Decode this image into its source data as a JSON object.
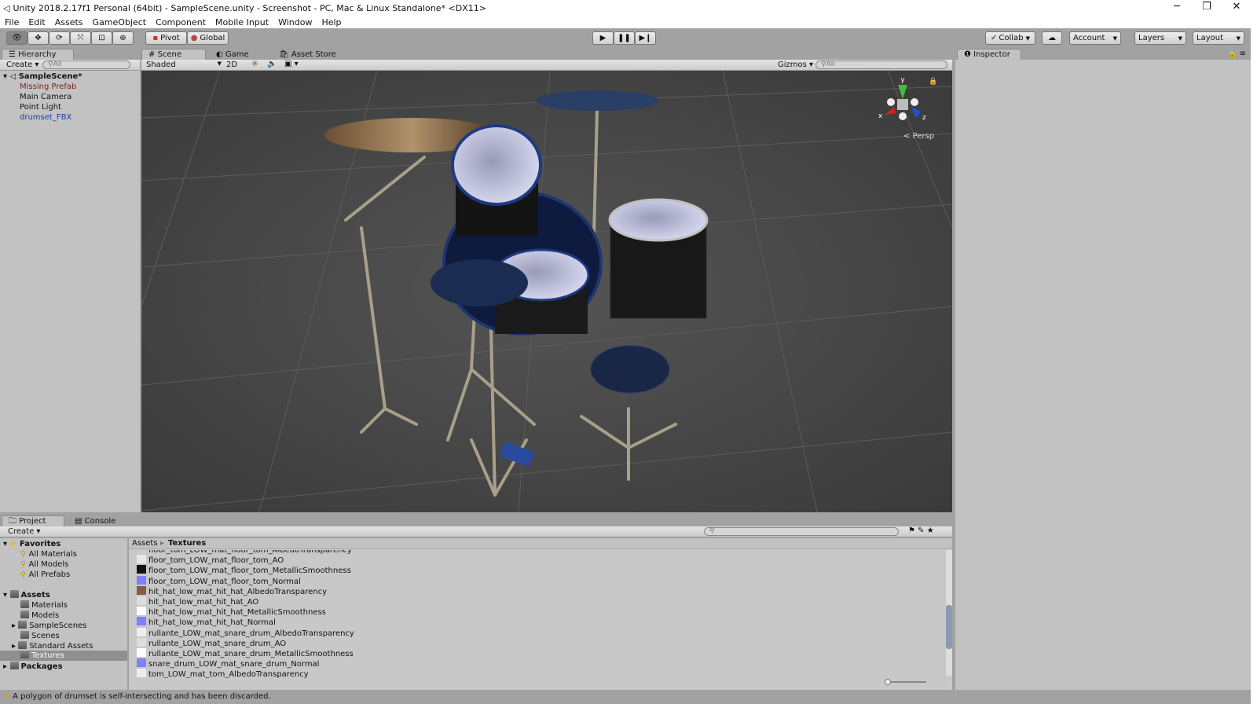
{
  "window": {
    "title": "Unity 2018.2.17f1 Personal (64bit) - SampleScene.unity - Screenshot - PC, Mac & Linux Standalone* <DX11>",
    "minimize": "─",
    "maximize": "❐",
    "close": "✕"
  },
  "menu": [
    "File",
    "Edit",
    "Assets",
    "GameObject",
    "Component",
    "Mobile Input",
    "Window",
    "Help"
  ],
  "toolbar": {
    "pivot": "Pivot",
    "global": "Global",
    "collab": "Collab",
    "account": "Account",
    "layers": "Layers",
    "layout": "Layout"
  },
  "hierarchy": {
    "tab": "Hierarchy",
    "create": "Create",
    "search_placeholder": "All",
    "scene": "SampleScene*",
    "items": [
      {
        "label": "Missing Prefab",
        "color": "#7a1e1e"
      },
      {
        "label": "Main Camera",
        "color": "#111111"
      },
      {
        "label": "Point Light",
        "color": "#111111"
      },
      {
        "label": "drumset_FBX",
        "color": "#1c3fa6"
      }
    ]
  },
  "scene": {
    "tabs": [
      "Scene",
      "Game",
      "Asset Store"
    ],
    "shading": "Shaded",
    "mode2d": "2D",
    "gizmos": "Gizmos",
    "search_placeholder": "All",
    "persp": "Persp",
    "axes": {
      "x": "x",
      "y": "y",
      "z": "z"
    }
  },
  "inspector": {
    "tab": "Inspector"
  },
  "project": {
    "tabs": [
      "Project",
      "Console"
    ],
    "create": "Create",
    "favorites": {
      "label": "Favorites",
      "items": [
        "All Materials",
        "All Models",
        "All Prefabs"
      ]
    },
    "assets": {
      "label": "Assets",
      "items": [
        "Materials",
        "Models",
        "SampleScenes",
        "Scenes",
        "Standard Assets",
        "Textures"
      ]
    },
    "packages": "Packages",
    "breadcrumb": [
      "Assets",
      "Textures"
    ],
    "files": [
      {
        "name": "floor_tom_LOW_mat_floor_tom_AlbedoTransparency",
        "thumb": "#cccccc"
      },
      {
        "name": "floor_tom_LOW_mat_floor_tom_AO",
        "thumb": "#e8e8e8"
      },
      {
        "name": "floor_tom_LOW_mat_floor_tom_MetallicSmoothness",
        "thumb": "#111111"
      },
      {
        "name": "floor_tom_LOW_mat_floor_tom_Normal",
        "thumb": "#7f7fff"
      },
      {
        "name": "hit_hat_low_mat_hit_hat_AlbedoTransparency",
        "thumb": "#8a5a48"
      },
      {
        "name": "hit_hat_low_mat_hit_hat_AO",
        "thumb": "#dddddd"
      },
      {
        "name": "hit_hat_low_mat_hit_hat_MetallicSmoothness",
        "thumb": "#ffffff"
      },
      {
        "name": "hit_hat_low_mat_hit_hat_Normal",
        "thumb": "#7f7fff"
      },
      {
        "name": "rullante_LOW_mat_snare_drum_AlbedoTransparency",
        "thumb": "#eeeeee"
      },
      {
        "name": "rullante_LOW_mat_snare_drum_AO",
        "thumb": "#dddddd"
      },
      {
        "name": "rullante_LOW_mat_snare_drum_MetallicSmoothness",
        "thumb": "#ffffff"
      },
      {
        "name": "snare_drum_LOW_mat_snare_drum_Normal",
        "thumb": "#7f7fff"
      },
      {
        "name": "tom_LOW_mat_tom_AlbedoTransparency",
        "thumb": "#eeeeee"
      }
    ]
  },
  "status": {
    "message": "A polygon of drumset is self-intersecting and has been discarded."
  }
}
